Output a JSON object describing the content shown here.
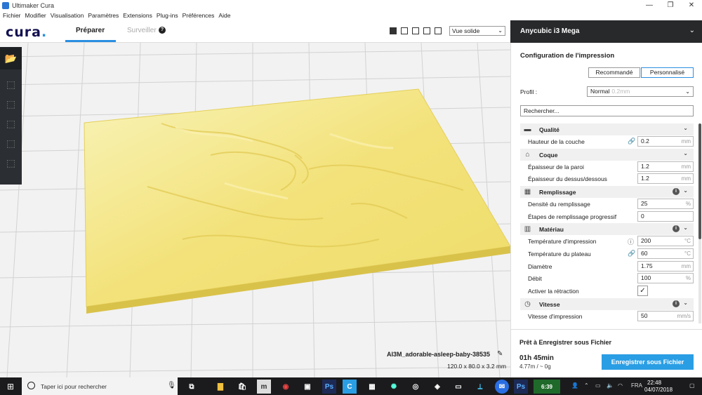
{
  "window": {
    "title": "Ultimaker Cura",
    "controls": [
      "—",
      "❐",
      "✕"
    ]
  },
  "menu": [
    "Fichier",
    "Modifier",
    "Visualisation",
    "Paramètres",
    "Extensions",
    "Plug-ins",
    "Préférences",
    "Aide"
  ],
  "header": {
    "logo": "cura",
    "logo_dot": ".",
    "tabs": {
      "prepare": "Préparer",
      "monitor": "Surveiller"
    },
    "help": "?",
    "view_mode": "Vue solide"
  },
  "printer": {
    "name": "Anycubic i3 Mega"
  },
  "settings": {
    "title": "Configuration de l'impression",
    "mode_recommended": "Recommandé",
    "mode_custom": "Personnalisé",
    "profile_label": "Profil :",
    "profile_value": "Normal",
    "profile_sub": "0.2mm",
    "search_placeholder": "Rechercher...",
    "categories": [
      {
        "label": "Qualité",
        "icon": "quality-icon",
        "info": false
      },
      {
        "label": "Coque",
        "icon": "shell-icon",
        "info": false
      },
      {
        "label": "Remplissage",
        "icon": "infill-icon",
        "info": true
      },
      {
        "label": "Matériau",
        "icon": "material-icon",
        "info": true
      },
      {
        "label": "Vitesse",
        "icon": "speed-icon",
        "info": true
      }
    ],
    "rows": [
      {
        "label": "Hauteur de la couche",
        "value": "0.2",
        "unit": "mm",
        "icon": "link-icon"
      },
      {
        "label": "Épaisseur de la paroi",
        "value": "1.2",
        "unit": "mm"
      },
      {
        "label": "Épaisseur du dessus/dessous",
        "value": "1.2",
        "unit": "mm"
      },
      {
        "label": "Densité du remplissage",
        "value": "25",
        "unit": "%"
      },
      {
        "label": "Étapes de remplissage progressif",
        "value": "0",
        "unit": ""
      },
      {
        "label": "Température d'impression",
        "value": "200",
        "unit": "°C",
        "icon": "info-icon"
      },
      {
        "label": "Température du plateau",
        "value": "60",
        "unit": "°C",
        "icon": "link-icon"
      },
      {
        "label": "Diamètre",
        "value": "1.75",
        "unit": "mm"
      },
      {
        "label": "Débit",
        "value": "100",
        "unit": "%"
      },
      {
        "label": "Activer la rétraction",
        "checked": true
      },
      {
        "label": "Vitesse d'impression",
        "value": "50",
        "unit": "mm/s"
      }
    ]
  },
  "model": {
    "name": "AI3M_adorable-asleep-baby-38535",
    "dims": "120.0 x 80.0 x 3.2 mm"
  },
  "output": {
    "ready": "Prêt à Enregistrer sous Fichier",
    "time": "01h 45min",
    "material": "4.77m / ~ 0g",
    "save": "Enregistrer sous Fichier"
  },
  "taskbar": {
    "search_placeholder": "Taper ici pour rechercher",
    "battery_label": "6:39",
    "lang": "FRA",
    "time": "22:48",
    "date": "04/07/2018"
  },
  "colors": {
    "accent": "#2a9ee4",
    "model": "#f5df6e",
    "sidebar_dark": "#27292b"
  }
}
